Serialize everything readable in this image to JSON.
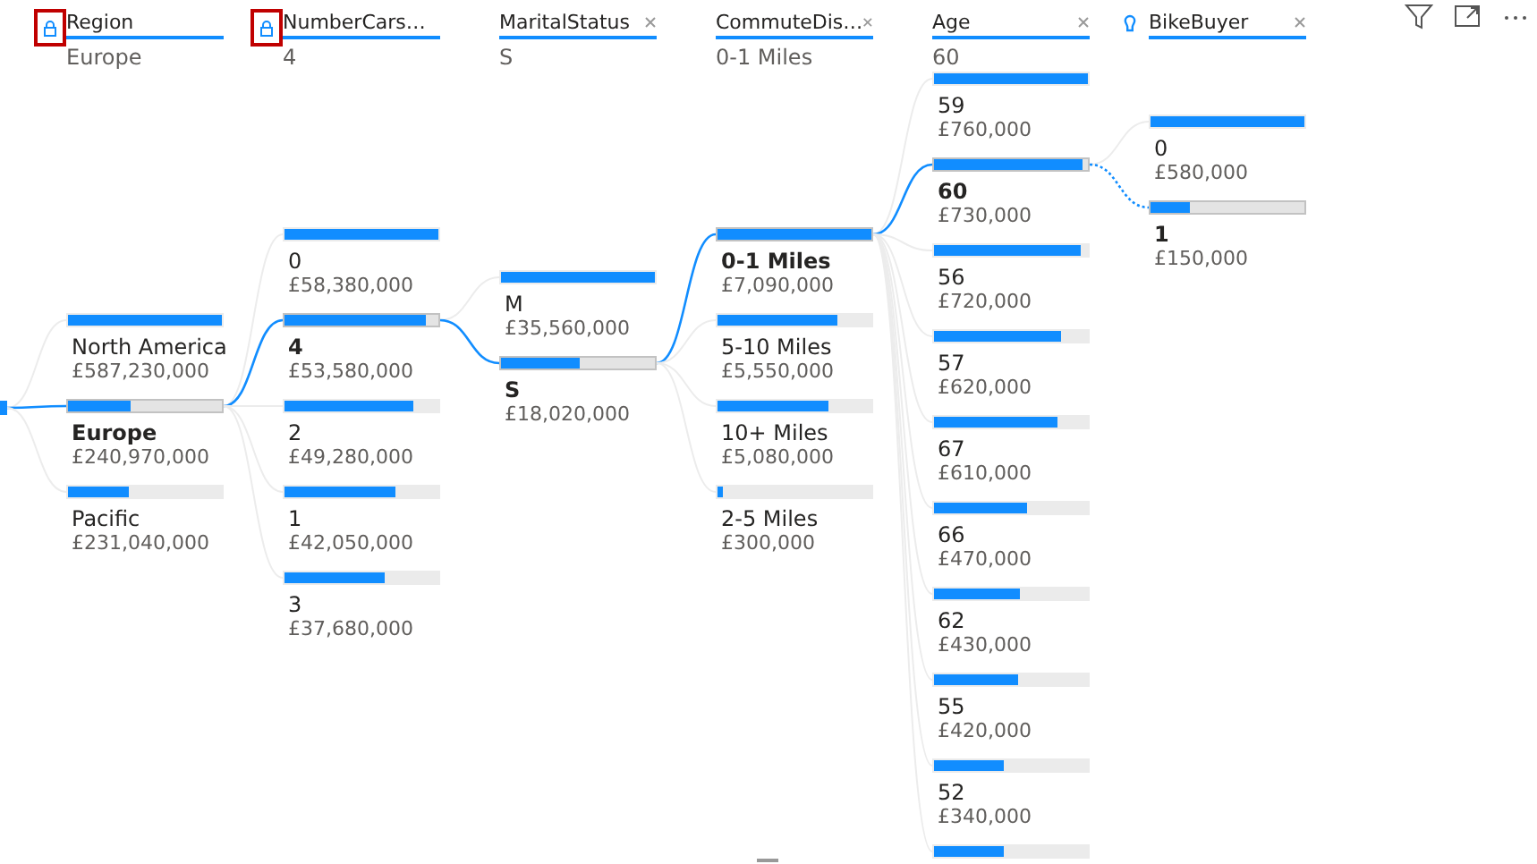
{
  "columns": [
    {
      "title": "Region",
      "kind": "locked",
      "selection": "Europe",
      "nodes": [
        {
          "label": "North America",
          "value": "£587,230,000",
          "level": 1.0,
          "selected": false
        },
        {
          "label": "Europe",
          "value": "£240,970,000",
          "level": 0.41,
          "selected": true
        },
        {
          "label": "Pacific",
          "value": "£231,040,000",
          "level": 0.39,
          "selected": false
        }
      ]
    },
    {
      "title": "NumberCars…",
      "kind": "locked",
      "selection": "4",
      "nodes": [
        {
          "label": "0",
          "value": "£58,380,000",
          "level": 1.0,
          "selected": false
        },
        {
          "label": "4",
          "value": "£53,580,000",
          "level": 0.92,
          "selected": true
        },
        {
          "label": "2",
          "value": "£49,280,000",
          "level": 0.84,
          "selected": false
        },
        {
          "label": "1",
          "value": "£42,050,000",
          "level": 0.72,
          "selected": false
        },
        {
          "label": "3",
          "value": "£37,680,000",
          "level": 0.65,
          "selected": false
        }
      ]
    },
    {
      "title": "MaritalStatus",
      "kind": "removable",
      "selection": "S",
      "nodes": [
        {
          "label": "M",
          "value": "£35,560,000",
          "level": 1.0,
          "selected": false
        },
        {
          "label": "S",
          "value": "£18,020,000",
          "level": 0.51,
          "selected": true
        }
      ]
    },
    {
      "title": "CommuteDis…",
      "kind": "removable",
      "selection": "0-1 Miles",
      "nodes": [
        {
          "label": "0-1 Miles",
          "value": "£7,090,000",
          "level": 1.0,
          "selected": true
        },
        {
          "label": "5-10 Miles",
          "value": "£5,550,000",
          "level": 0.78,
          "selected": false
        },
        {
          "label": "10+ Miles",
          "value": "£5,080,000",
          "level": 0.72,
          "selected": false
        },
        {
          "label": "2-5 Miles",
          "value": "£300,000",
          "level": 0.04,
          "selected": false
        }
      ]
    },
    {
      "title": "Age",
      "kind": "removable",
      "selection": "60",
      "nodes": [
        {
          "label": "59",
          "value": "£760,000",
          "level": 1.0,
          "selected": false
        },
        {
          "label": "60",
          "value": "£730,000",
          "level": 0.96,
          "selected": true
        },
        {
          "label": "56",
          "value": "£720,000",
          "level": 0.95,
          "selected": false
        },
        {
          "label": "57",
          "value": "£620,000",
          "level": 0.82,
          "selected": false
        },
        {
          "label": "67",
          "value": "£610,000",
          "level": 0.8,
          "selected": false
        },
        {
          "label": "66",
          "value": "£470,000",
          "level": 0.61,
          "selected": false
        },
        {
          "label": "62",
          "value": "£430,000",
          "level": 0.56,
          "selected": false
        },
        {
          "label": "55",
          "value": "£420,000",
          "level": 0.55,
          "selected": false
        },
        {
          "label": "52",
          "value": "£340,000",
          "level": 0.45,
          "selected": false
        },
        {
          "level": 0.45,
          "selected": false
        }
      ]
    },
    {
      "title": "BikeBuyer",
      "kind": "explain",
      "nodes": [
        {
          "label": "0",
          "value": "£580,000",
          "level": 1.0,
          "selected": false
        },
        {
          "label": "1",
          "value": "£150,000",
          "level": 0.26,
          "selected": true
        }
      ]
    }
  ]
}
